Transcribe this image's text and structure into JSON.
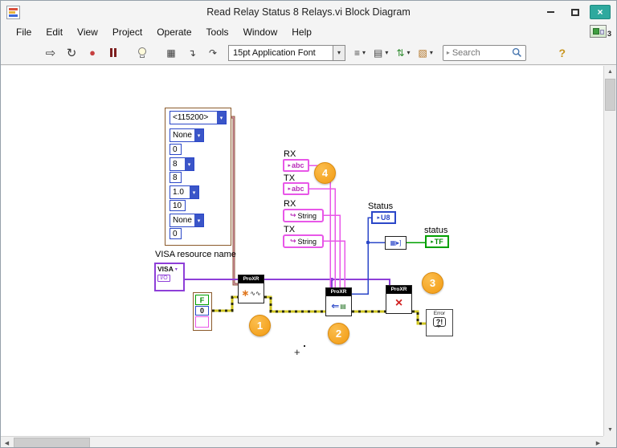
{
  "window": {
    "title": "Read Relay Status 8 Relays.vi Block Diagram",
    "badge": "3"
  },
  "menu": {
    "items": [
      "File",
      "Edit",
      "View",
      "Project",
      "Operate",
      "Tools",
      "Window",
      "Help"
    ]
  },
  "toolbar": {
    "font_selector": "15pt Application Font",
    "search_placeholder": "Search",
    "help": "?"
  },
  "icons": {
    "run": "⇨",
    "run_continuous": "↻",
    "abort": "●",
    "retain_wires": "▦",
    "step_into": "↴",
    "step_over": "↷",
    "align": "≡",
    "distribute": "▤",
    "reorder": "⇅",
    "cleanup": "▧",
    "dropdown": "▾",
    "terminal_arrow": "▸",
    "string_curve": "↪",
    "index_node": "▦▸]",
    "configure_star": "∗",
    "configure_wave": "∿∿",
    "read_arrow": "⇐",
    "read_doc": "▤",
    "close_x": "×",
    "close": "×",
    "search_caret": "▸",
    "scroll_up": "▲",
    "scroll_down": "▼",
    "scroll_left": "◀",
    "scroll_right": "▶"
  },
  "diagram": {
    "cluster_items": [
      {
        "label": "<115200>"
      },
      {
        "label": "None"
      },
      {
        "label": "0"
      },
      {
        "label": "8"
      },
      {
        "label": "8"
      },
      {
        "label": "1.0"
      },
      {
        "label": "10"
      },
      {
        "label": "None"
      },
      {
        "label": "0"
      }
    ],
    "visa": {
      "label": "VISA resource name",
      "title": "VISA",
      "io": "I/O"
    },
    "rx_abc": {
      "label": "RX",
      "text": "abc"
    },
    "tx_abc": {
      "label": "TX",
      "text": "abc"
    },
    "rx_string": {
      "label": "RX",
      "text": "String"
    },
    "tx_string": {
      "label": "TX",
      "text": "String"
    },
    "status_u8": {
      "label": "Status",
      "text": "U8"
    },
    "status_tf": {
      "label": "status",
      "text": "TF"
    },
    "error_constant": {
      "status": "F",
      "code": "0",
      "source": ""
    },
    "subvis": {
      "configure": "ProXR",
      "read": "ProXR",
      "close": "ProXR"
    },
    "error_handler": {
      "title": "Error",
      "text": "?!"
    },
    "annotations": {
      "n1": "1",
      "n2": "2",
      "n3": "3",
      "n4": "4"
    },
    "cursor_mark": "+"
  },
  "colors": {
    "string_pink": "#E857E8",
    "numeric_blue": "#2B47C8",
    "boolean_green": "#00A000",
    "visa_purple": "#8E3FD8",
    "cluster_brown": "#8B5A2B",
    "error_wire_yellow": "#CFC520",
    "annotation_orange": "#F29A12",
    "close_button_teal": "#2FA99E"
  }
}
